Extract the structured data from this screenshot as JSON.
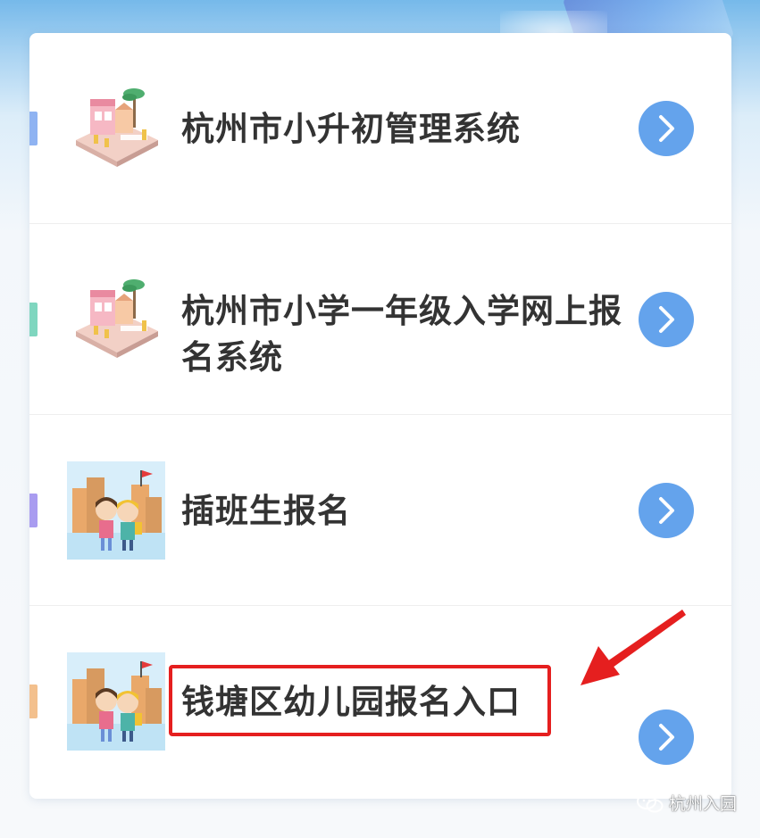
{
  "menu": {
    "items": [
      {
        "label": "杭州市小升初管理系统",
        "accent_color": "#8fb3f2",
        "icon": "shop-street-illustration-icon",
        "arrow_icon": "chevron-right-icon"
      },
      {
        "label": "杭州市小学一年级入学网上报名系统",
        "accent_color": "#7fd6bf",
        "icon": "shop-street-illustration-icon",
        "arrow_icon": "chevron-right-icon"
      },
      {
        "label": "插班生报名",
        "accent_color": "#a99cf0",
        "icon": "kids-walking-illustration-icon",
        "arrow_icon": "chevron-right-icon"
      },
      {
        "label": "钱塘区幼儿园报名入口",
        "accent_color": "#f3c08d",
        "icon": "kids-walking-illustration-icon",
        "arrow_icon": "chevron-right-icon"
      }
    ]
  },
  "annotation": {
    "highlight_color": "#e51f1f"
  },
  "watermark": {
    "text": "杭州入园",
    "icon": "wechat-icon"
  }
}
